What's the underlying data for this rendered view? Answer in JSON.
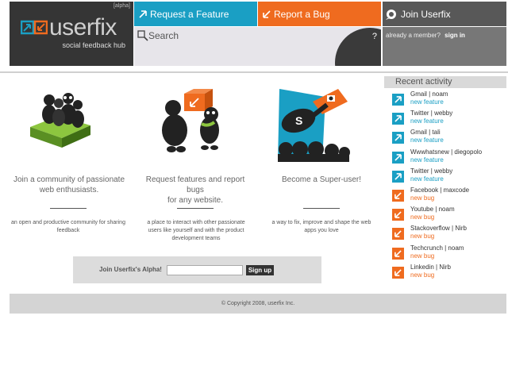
{
  "header": {
    "alpha_tag": "[alpha]",
    "logo_text": "userfix",
    "tagline": "social feedback hub",
    "nav_request": "Request a Feature",
    "nav_report": "Report a Bug",
    "nav_join": "Join Userfix",
    "search_placeholder": "Search",
    "help_label": "?",
    "member_prompt": "already a member?",
    "signin_label": "sign in"
  },
  "columns": [
    {
      "title": "Join a community of passionate web enthusiasts.",
      "desc": "an open and productive community for sharing feedback"
    },
    {
      "title_lines": [
        "Request features and report",
        "bugs",
        "for any website."
      ],
      "desc": "a place to interact with other passionate users like yourself and with the product development teams"
    },
    {
      "title": "Become a Super-user!",
      "desc": "a way to fix, improve and shape the web apps you love"
    }
  ],
  "signup": {
    "label": "Join Userfix's Alpha!",
    "input_value": "",
    "button_label": "Sign up"
  },
  "footer": {
    "copyright": "© Copyright 2008, userfix Inc."
  },
  "recent": {
    "title": "Recent activity",
    "items": [
      {
        "name": "Gmail | noam",
        "type": "new feature",
        "kind": "feature"
      },
      {
        "name": "Twitter | webby",
        "type": "new feature",
        "kind": "feature"
      },
      {
        "name": "Gmail | tali",
        "type": "new feature",
        "kind": "feature"
      },
      {
        "name": "Wwwhatsnew | diegopolo",
        "type": "new feature",
        "kind": "feature"
      },
      {
        "name": "Twitter | webby",
        "type": "new feature",
        "kind": "feature"
      },
      {
        "name": "Facebook | maxcode",
        "type": "new bug",
        "kind": "bug"
      },
      {
        "name": "Youtube | noam",
        "type": "new bug",
        "kind": "bug"
      },
      {
        "name": "Stackoverflow | Nirb",
        "type": "new bug",
        "kind": "bug"
      },
      {
        "name": "Techcrunch | noam",
        "type": "new bug",
        "kind": "bug"
      },
      {
        "name": "Linkedin | Nirb",
        "type": "new bug",
        "kind": "bug"
      }
    ]
  },
  "colors": {
    "feature_blue": "#1a9fc4",
    "bug_orange": "#ef6b1f",
    "header_dark": "#353535"
  }
}
